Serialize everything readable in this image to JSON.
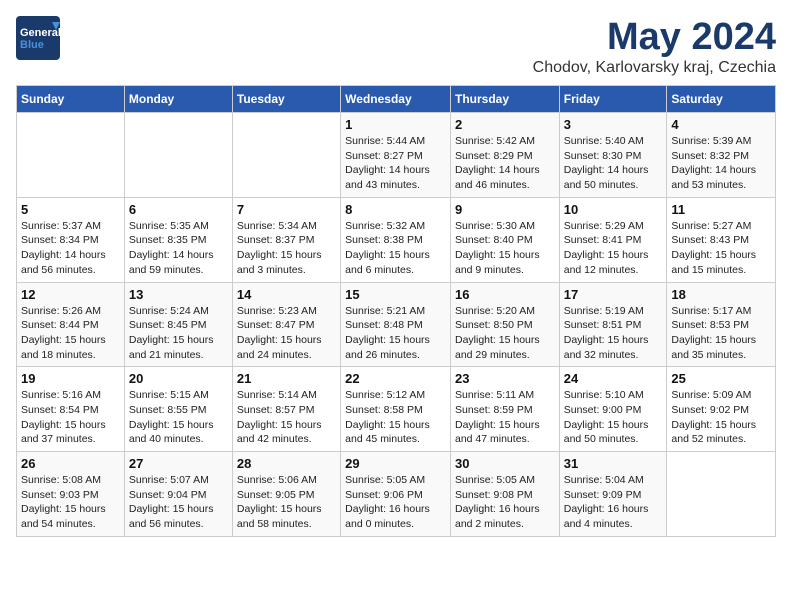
{
  "header": {
    "logo_general": "General",
    "logo_blue": "Blue",
    "title": "May 2024",
    "location": "Chodov, Karlovarsky kraj, Czechia"
  },
  "columns": [
    "Sunday",
    "Monday",
    "Tuesday",
    "Wednesday",
    "Thursday",
    "Friday",
    "Saturday"
  ],
  "weeks": [
    [
      {
        "day": "",
        "info": ""
      },
      {
        "day": "",
        "info": ""
      },
      {
        "day": "",
        "info": ""
      },
      {
        "day": "1",
        "info": "Sunrise: 5:44 AM\nSunset: 8:27 PM\nDaylight: 14 hours\nand 43 minutes."
      },
      {
        "day": "2",
        "info": "Sunrise: 5:42 AM\nSunset: 8:29 PM\nDaylight: 14 hours\nand 46 minutes."
      },
      {
        "day": "3",
        "info": "Sunrise: 5:40 AM\nSunset: 8:30 PM\nDaylight: 14 hours\nand 50 minutes."
      },
      {
        "day": "4",
        "info": "Sunrise: 5:39 AM\nSunset: 8:32 PM\nDaylight: 14 hours\nand 53 minutes."
      }
    ],
    [
      {
        "day": "5",
        "info": "Sunrise: 5:37 AM\nSunset: 8:34 PM\nDaylight: 14 hours\nand 56 minutes."
      },
      {
        "day": "6",
        "info": "Sunrise: 5:35 AM\nSunset: 8:35 PM\nDaylight: 14 hours\nand 59 minutes."
      },
      {
        "day": "7",
        "info": "Sunrise: 5:34 AM\nSunset: 8:37 PM\nDaylight: 15 hours\nand 3 minutes."
      },
      {
        "day": "8",
        "info": "Sunrise: 5:32 AM\nSunset: 8:38 PM\nDaylight: 15 hours\nand 6 minutes."
      },
      {
        "day": "9",
        "info": "Sunrise: 5:30 AM\nSunset: 8:40 PM\nDaylight: 15 hours\nand 9 minutes."
      },
      {
        "day": "10",
        "info": "Sunrise: 5:29 AM\nSunset: 8:41 PM\nDaylight: 15 hours\nand 12 minutes."
      },
      {
        "day": "11",
        "info": "Sunrise: 5:27 AM\nSunset: 8:43 PM\nDaylight: 15 hours\nand 15 minutes."
      }
    ],
    [
      {
        "day": "12",
        "info": "Sunrise: 5:26 AM\nSunset: 8:44 PM\nDaylight: 15 hours\nand 18 minutes."
      },
      {
        "day": "13",
        "info": "Sunrise: 5:24 AM\nSunset: 8:45 PM\nDaylight: 15 hours\nand 21 minutes."
      },
      {
        "day": "14",
        "info": "Sunrise: 5:23 AM\nSunset: 8:47 PM\nDaylight: 15 hours\nand 24 minutes."
      },
      {
        "day": "15",
        "info": "Sunrise: 5:21 AM\nSunset: 8:48 PM\nDaylight: 15 hours\nand 26 minutes."
      },
      {
        "day": "16",
        "info": "Sunrise: 5:20 AM\nSunset: 8:50 PM\nDaylight: 15 hours\nand 29 minutes."
      },
      {
        "day": "17",
        "info": "Sunrise: 5:19 AM\nSunset: 8:51 PM\nDaylight: 15 hours\nand 32 minutes."
      },
      {
        "day": "18",
        "info": "Sunrise: 5:17 AM\nSunset: 8:53 PM\nDaylight: 15 hours\nand 35 minutes."
      }
    ],
    [
      {
        "day": "19",
        "info": "Sunrise: 5:16 AM\nSunset: 8:54 PM\nDaylight: 15 hours\nand 37 minutes."
      },
      {
        "day": "20",
        "info": "Sunrise: 5:15 AM\nSunset: 8:55 PM\nDaylight: 15 hours\nand 40 minutes."
      },
      {
        "day": "21",
        "info": "Sunrise: 5:14 AM\nSunset: 8:57 PM\nDaylight: 15 hours\nand 42 minutes."
      },
      {
        "day": "22",
        "info": "Sunrise: 5:12 AM\nSunset: 8:58 PM\nDaylight: 15 hours\nand 45 minutes."
      },
      {
        "day": "23",
        "info": "Sunrise: 5:11 AM\nSunset: 8:59 PM\nDaylight: 15 hours\nand 47 minutes."
      },
      {
        "day": "24",
        "info": "Sunrise: 5:10 AM\nSunset: 9:00 PM\nDaylight: 15 hours\nand 50 minutes."
      },
      {
        "day": "25",
        "info": "Sunrise: 5:09 AM\nSunset: 9:02 PM\nDaylight: 15 hours\nand 52 minutes."
      }
    ],
    [
      {
        "day": "26",
        "info": "Sunrise: 5:08 AM\nSunset: 9:03 PM\nDaylight: 15 hours\nand 54 minutes."
      },
      {
        "day": "27",
        "info": "Sunrise: 5:07 AM\nSunset: 9:04 PM\nDaylight: 15 hours\nand 56 minutes."
      },
      {
        "day": "28",
        "info": "Sunrise: 5:06 AM\nSunset: 9:05 PM\nDaylight: 15 hours\nand 58 minutes."
      },
      {
        "day": "29",
        "info": "Sunrise: 5:05 AM\nSunset: 9:06 PM\nDaylight: 16 hours\nand 0 minutes."
      },
      {
        "day": "30",
        "info": "Sunrise: 5:05 AM\nSunset: 9:08 PM\nDaylight: 16 hours\nand 2 minutes."
      },
      {
        "day": "31",
        "info": "Sunrise: 5:04 AM\nSunset: 9:09 PM\nDaylight: 16 hours\nand 4 minutes."
      },
      {
        "day": "",
        "info": ""
      }
    ]
  ]
}
